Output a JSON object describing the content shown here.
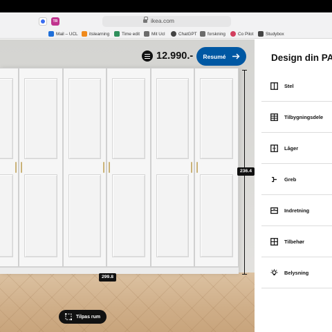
{
  "browser": {
    "url": "ikea.com",
    "tab_icon_text": "TR",
    "bookmarks": [
      {
        "label": "Mail – UCL",
        "color": "#1e6fd9"
      },
      {
        "label": "itslearning",
        "color": "#f08a1c"
      },
      {
        "label": "Time edit",
        "color": "#2f8f5b"
      },
      {
        "label": "Mit Ucl",
        "color": "#6b6b6b"
      },
      {
        "label": "ChatGPT",
        "color": "#444444"
      },
      {
        "label": "forskning",
        "color": "#6b6b6b"
      },
      {
        "label": "Co Pilot",
        "color": "#d23f5e"
      },
      {
        "label": "Studybox",
        "color": "#444444"
      }
    ]
  },
  "planner": {
    "price": "12.990.-",
    "resume_label": "Resumé",
    "height_dimension": "236.4",
    "width_dimension": "299.8",
    "adjust_room_label": "Tilpas rum",
    "accent_color": "#0058a3"
  },
  "sidebar": {
    "title": "Design din PAX",
    "items": [
      {
        "label": "Stel",
        "icon": "frame-icon"
      },
      {
        "label": "Tilbygningsdele",
        "icon": "grid-icon"
      },
      {
        "label": "Låger",
        "icon": "door-icon"
      },
      {
        "label": "Greb",
        "icon": "handle-icon"
      },
      {
        "label": "Indretning",
        "icon": "drawer-icon"
      },
      {
        "label": "Tilbehør",
        "icon": "accessory-grid-icon"
      },
      {
        "label": "Belysning",
        "icon": "light-icon"
      }
    ]
  }
}
